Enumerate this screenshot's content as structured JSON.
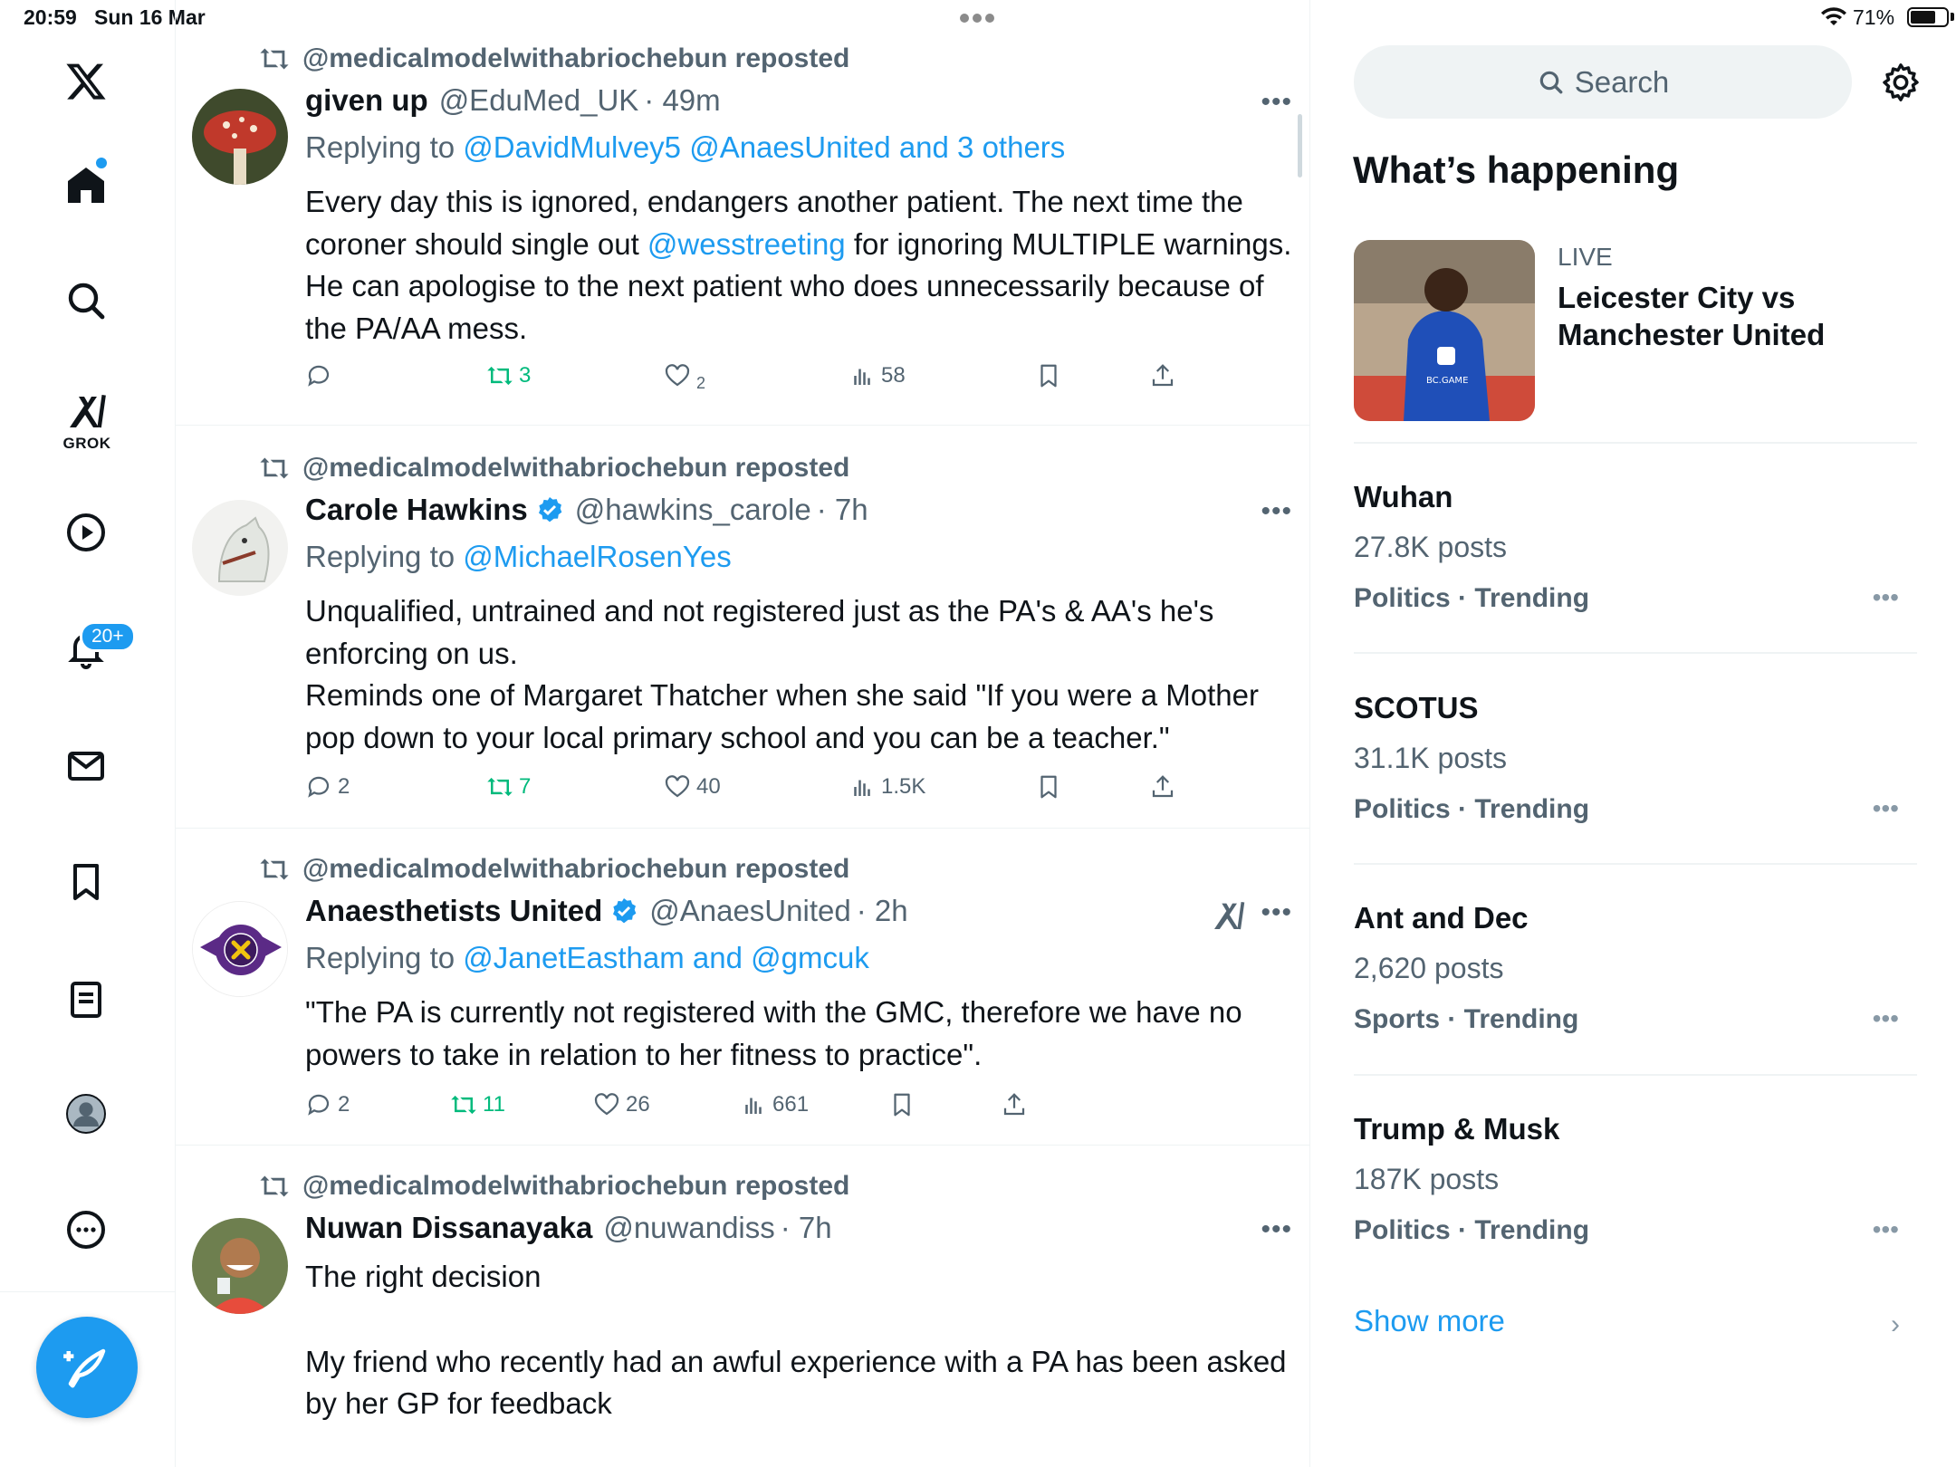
{
  "statusbar": {
    "time": "20:59",
    "date": "Sun 16 Mar",
    "battery": "71%",
    "battery_level": 0.71
  },
  "nav": {
    "grok_label": "GROK",
    "notifications_badge": "20+"
  },
  "tweets": [
    {
      "reposted_by": "@medicalmodelwithabriochebun reposted",
      "name": "given up",
      "handle": "@EduMed_UK",
      "time": "· 49m",
      "replying_prefix": "Replying to",
      "replying_to": "@DavidMulvey5 @AnaesUnited and 3 others",
      "text_1": "Every day this is ignored, endangers another patient. The next time the coroner should single out ",
      "mention": "@wesstreeting",
      "text_2": " for ignoring MULTIPLE warnings. He can apologise to the next patient who does unnecessarily because of the PA/AA mess.",
      "replies": "",
      "reposts": "3",
      "likes": "2",
      "views": "58"
    },
    {
      "reposted_by": "@medicalmodelwithabriochebun reposted",
      "name": "Carole Hawkins",
      "handle": "@hawkins_carole",
      "time": "· 7h",
      "replying_prefix": "Replying to",
      "replying_to": "@MichaelRosenYes",
      "text_1": "Unqualified, untrained and not registered just as the PA's & AA's he's enforcing on us.",
      "text_2": "Reminds one of Margaret Thatcher when she said \"If you were a Mother pop down to your local primary school and you can be a teacher.\"",
      "replies": "2",
      "reposts": "7",
      "likes": "40",
      "views": "1.5K"
    },
    {
      "reposted_by": "@medicalmodelwithabriochebun reposted",
      "name": "Anaesthetists United",
      "handle": "@AnaesUnited",
      "time": "· 2h",
      "replying_prefix": "Replying to",
      "replying_to": "@JanetEastham and @gmcuk",
      "text_1": "\"The PA is currently not registered with the GMC, therefore we have no powers to take in relation to her fitness to practice\".",
      "replies": "2",
      "reposts": "11",
      "likes": "26",
      "views": "661"
    },
    {
      "reposted_by": "@medicalmodelwithabriochebun reposted",
      "name": "Nuwan Dissanayaka",
      "handle": "@nuwandiss",
      "time": "· 7h",
      "text_1": "The right decision",
      "text_2": "My friend who recently had an awful experience with a PA has been asked by her GP for feedback"
    }
  ],
  "sidebar": {
    "search_placeholder": "Search",
    "whats_happening": "What’s happening",
    "live_label": "LIVE",
    "live_title": "Leicester City vs Manchester United",
    "trends": [
      {
        "name": "Wuhan",
        "posts": "27.8K posts",
        "category": "Politics · Trending"
      },
      {
        "name": "SCOTUS",
        "posts": "31.1K posts",
        "category": "Politics · Trending"
      },
      {
        "name": "Ant and Dec",
        "posts": "2,620 posts",
        "category": "Sports · Trending"
      },
      {
        "name": "Trump & Musk",
        "posts": "187K posts",
        "category": "Politics · Trending"
      }
    ],
    "show_more": "Show more"
  },
  "colors": {
    "accent": "#1d9bf0",
    "repost_green": "#00ba7c",
    "muted": "#536471"
  }
}
